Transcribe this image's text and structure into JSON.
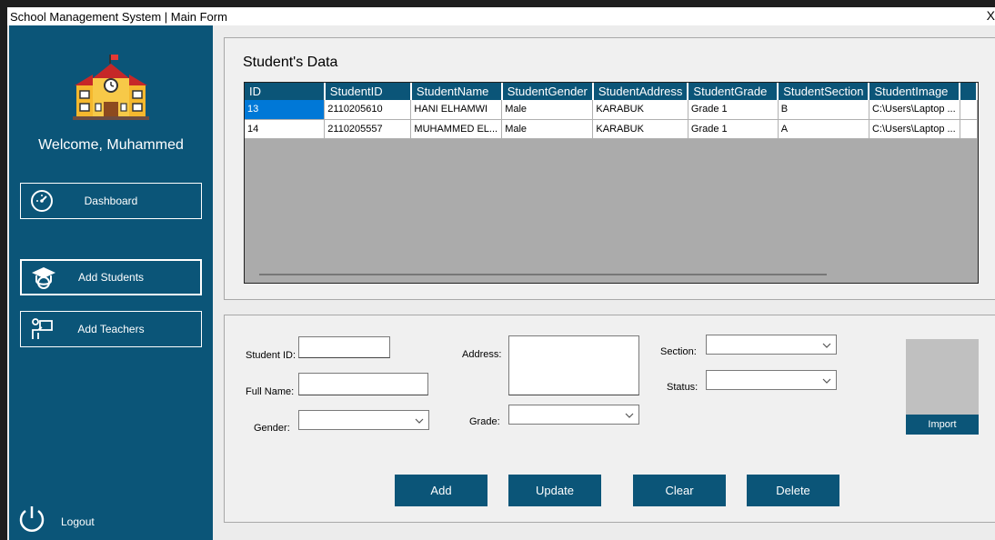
{
  "window": {
    "title": "School Management System | Main Form",
    "close_glyph": "X"
  },
  "sidebar": {
    "welcome": "Welcome, Muhammed",
    "nav": {
      "dashboard": "Dashboard",
      "add_students": "Add Students",
      "add_teachers": "Add Teachers"
    },
    "logout": "Logout",
    "active_item": "add_students"
  },
  "students_panel": {
    "heading": "Student's Data",
    "columns": [
      "ID",
      "StudentID",
      "StudentName",
      "StudentGender",
      "StudentAddress",
      "StudentGrade",
      "StudentSection",
      "StudentImage"
    ],
    "rows": [
      [
        "13",
        "2110205610",
        "HANI ELHAMWI",
        "Male",
        "KARABUK",
        "Grade 1",
        "B",
        "C:\\Users\\Laptop ..."
      ],
      [
        "14",
        "2110205557",
        "MUHAMMED EL...",
        "Male",
        "KARABUK",
        "Grade 1",
        "A",
        "C:\\Users\\Laptop ..."
      ]
    ],
    "selected_row": 0
  },
  "form": {
    "labels": {
      "student_id": "Student ID:",
      "full_name": "Full Name:",
      "gender": "Gender:",
      "address": "Address:",
      "grade": "Grade:",
      "section": "Section:",
      "status": "Status:"
    },
    "values": {
      "student_id": "",
      "full_name": "",
      "gender": "",
      "address": "",
      "grade": "",
      "section": "",
      "status": ""
    },
    "import_label": "Import",
    "buttons": {
      "add": "Add",
      "update": "Update",
      "clear": "Clear",
      "delete": "Delete"
    }
  },
  "colors": {
    "primary": "#0b5578",
    "selection": "#0078d7",
    "window_bg": "#ececec"
  },
  "icons": [
    "school-logo-icon",
    "speedometer-icon",
    "graduate-icon",
    "teacher-icon",
    "power-icon",
    "chevron-down-icon"
  ]
}
